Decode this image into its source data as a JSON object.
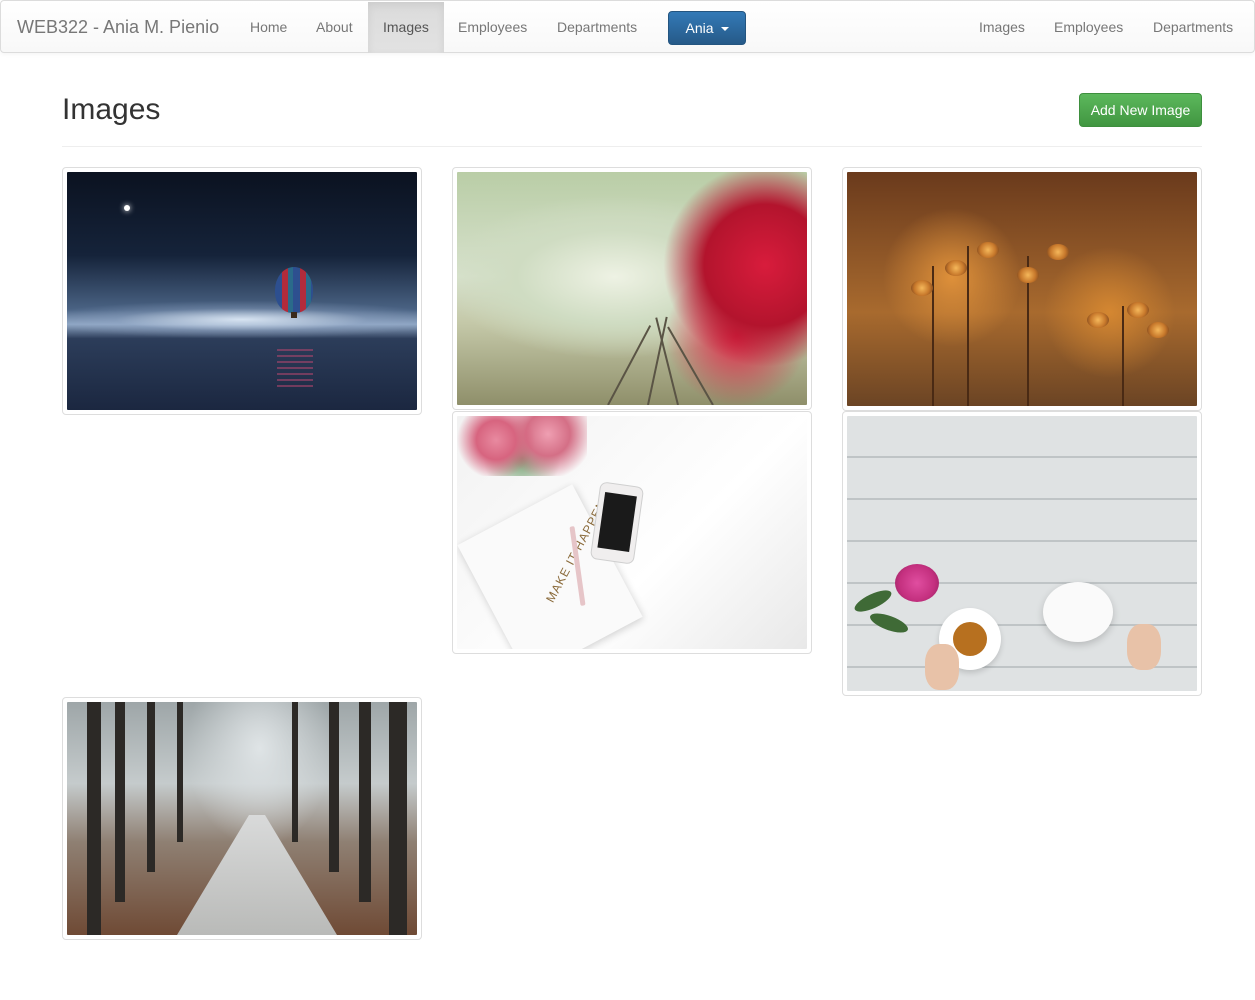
{
  "navbar": {
    "brand": "WEB322 - Ania M. Pienio",
    "left_items": [
      {
        "label": "Home",
        "active": false
      },
      {
        "label": "About",
        "active": false
      },
      {
        "label": "Images",
        "active": true
      },
      {
        "label": "Employees",
        "active": false
      },
      {
        "label": "Departments",
        "active": false
      }
    ],
    "user_menu": {
      "label": "Ania",
      "icon": "caret-down-icon"
    },
    "right_items": [
      {
        "label": "Images"
      },
      {
        "label": "Employees"
      },
      {
        "label": "Departments"
      }
    ],
    "colors": {
      "user_button": "#337ab7",
      "active_tab_bg": "#e7e7e7"
    }
  },
  "page": {
    "title": "Images",
    "add_button_label": "Add New Image",
    "add_button_color": "#5cb85c"
  },
  "gallery": {
    "images": [
      {
        "subject": "hot air balloon over water at night"
      },
      {
        "subject": "foggy railway tracks with red flowers"
      },
      {
        "subject": "golden dried flowers at sunset"
      },
      {
        "subject": "desk with notebook, phone and tulips",
        "notebook_text": "MAKE IT HAPPEN"
      },
      {
        "subject": "tea cup and teapot on white planks with peonies"
      },
      {
        "subject": "misty forest road"
      }
    ]
  }
}
